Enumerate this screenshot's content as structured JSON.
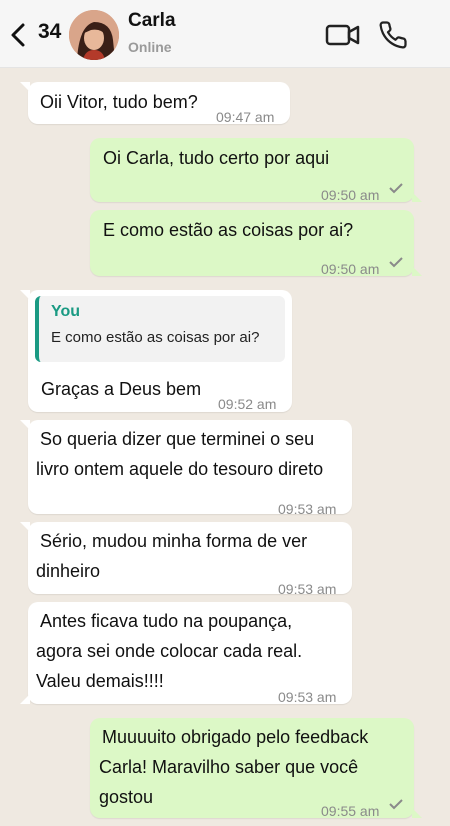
{
  "header": {
    "unread_count": "34",
    "contact_name": "Carla",
    "contact_status": "Online"
  },
  "messages": [
    {
      "direction": "in",
      "text": "Oii Vitor, tudo bem?",
      "time": "09:47 am"
    },
    {
      "direction": "out",
      "text": "Oi Carla, tudo certo por aqui",
      "time": "09:50 am",
      "status": "sent"
    },
    {
      "direction": "out",
      "text": "E como estão as coisas por ai?",
      "time": "09:50 am",
      "status": "sent"
    },
    {
      "direction": "in",
      "quote": {
        "author": "You",
        "text": "E como estão as coisas por ai?"
      },
      "text": "Graças a Deus bem",
      "time": "09:52 am"
    },
    {
      "direction": "in",
      "lines": [
        "So queria dizer que terminei o seu",
        "livro ontem aquele do tesouro direto"
      ],
      "time": "09:53 am"
    },
    {
      "direction": "in",
      "lines": [
        "Sério, mudou minha forma de ver",
        "dinheiro"
      ],
      "time": "09:53 am"
    },
    {
      "direction": "in",
      "lines": [
        "Antes ficava tudo na poupança,",
        "agora sei onde colocar cada real.",
        "Valeu demais!!!!"
      ],
      "time": "09:53 am"
    },
    {
      "direction": "out",
      "lines": [
        "Muuuuito obrigado pelo feedback",
        "Carla! Maravilho saber que você",
        "gostou"
      ],
      "time": "09:55 am",
      "status": "sent"
    }
  ],
  "colors": {
    "chat_background": "#efe9e1",
    "incoming_bubble": "#ffffff",
    "outgoing_bubble": "#dcf8c6",
    "quote_accent": "#1a9a83"
  },
  "icons": [
    "back-arrow-icon",
    "video-call-icon",
    "phone-call-icon",
    "check-icon"
  ]
}
